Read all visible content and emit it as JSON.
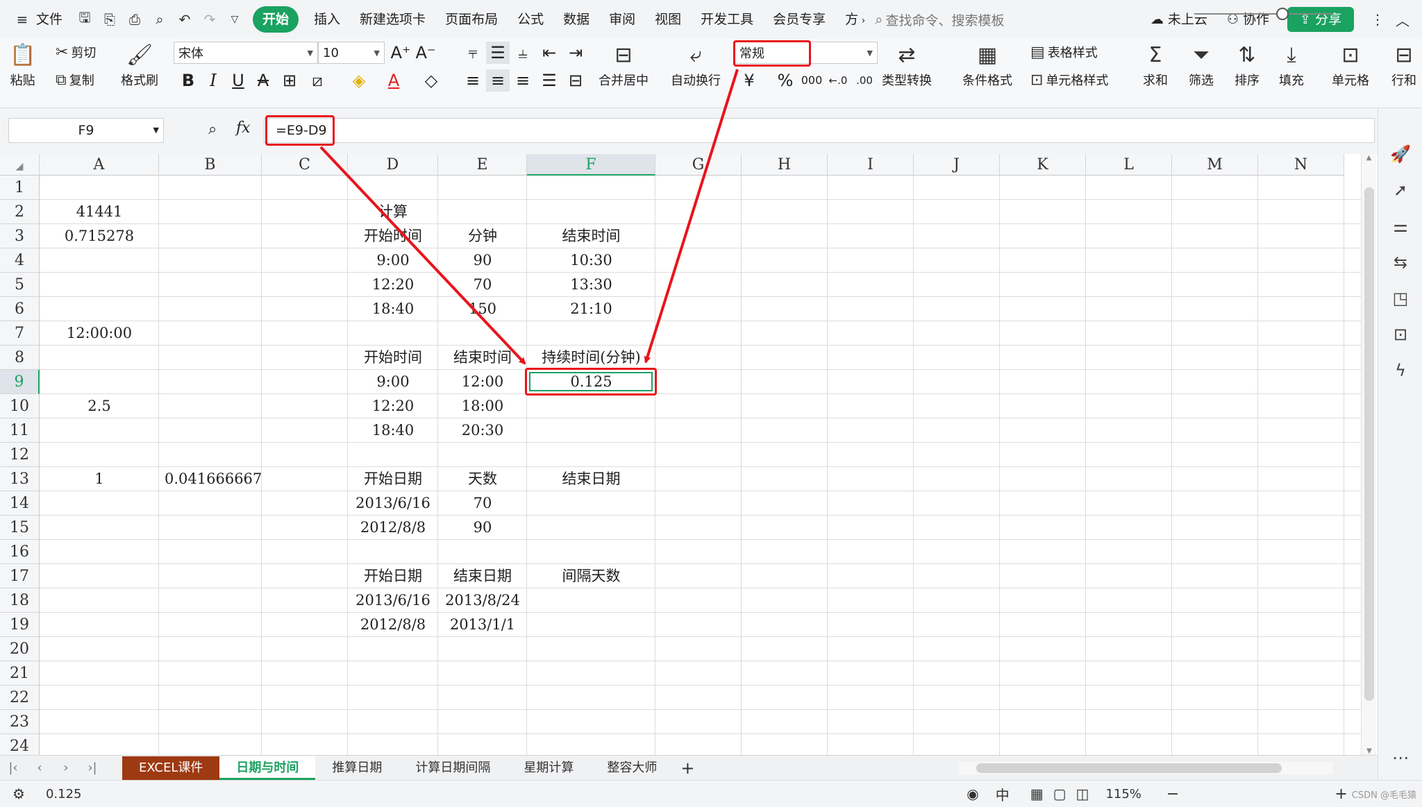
{
  "menu": {
    "file": "文件",
    "tabs": [
      "开始",
      "插入",
      "新建选项卡",
      "页面布局",
      "公式",
      "数据",
      "审阅",
      "视图",
      "开发工具",
      "会员专享",
      "方"
    ],
    "search_placeholder": "查找命令、搜索模板",
    "cloud": "未上云",
    "collab": "协作",
    "share": "分享"
  },
  "ribbon": {
    "paste": "粘贴",
    "cut": "剪切",
    "copy": "复制",
    "format_painter": "格式刷",
    "font_name": "宋体",
    "font_size": "10",
    "merge_center": "合并居中",
    "wrap_text": "自动换行",
    "number_format": "常规",
    "type_convert": "类型转换",
    "conditional_format": "条件格式",
    "table_style": "表格样式",
    "cell_style": "单元格样式",
    "sum": "求和",
    "filter": "筛选",
    "sort": "排序",
    "fill": "填充",
    "cell": "单元格",
    "row_col": "行和"
  },
  "formula_bar": {
    "name_box": "F9",
    "fx": "fx",
    "formula": "=E9-D9"
  },
  "grid": {
    "columns": [
      "A",
      "B",
      "C",
      "D",
      "E",
      "F",
      "G",
      "H",
      "I",
      "J",
      "K",
      "L",
      "M",
      "N"
    ],
    "rows": [
      "1",
      "2",
      "3",
      "4",
      "5",
      "6",
      "7",
      "8",
      "9",
      "10",
      "11",
      "12",
      "13",
      "14",
      "15",
      "16",
      "17",
      "18",
      "19",
      "20",
      "21",
      "22",
      "23",
      "24"
    ],
    "cells": {
      "A2": "41441",
      "A3": "0.715278",
      "A7": "12:00:00",
      "A10": "2.5",
      "A13": "1",
      "B13": "0.041666667",
      "D2": "计算",
      "D3": "开始时间",
      "E3": "分钟",
      "F3": "结束时间",
      "D4": "9:00",
      "E4": "90",
      "F4": "10:30",
      "D5": "12:20",
      "E5": "70",
      "F5": "13:30",
      "D6": "18:40",
      "E6": "150",
      "F6": "21:10",
      "D8": "开始时间",
      "E8": "结束时间",
      "F8": "持续时间(分钟)",
      "D9": "9:00",
      "E9": "12:00",
      "F9": "0.125",
      "D10": "12:20",
      "E10": "18:00",
      "D11": "18:40",
      "E11": "20:30",
      "D13": "开始日期",
      "E13": "天数",
      "F13": "结束日期",
      "D14": "2013/6/16",
      "E14": "70",
      "D15": "2012/8/8",
      "E15": "90",
      "D17": "开始日期",
      "E17": "结束日期",
      "F17": "间隔天数",
      "D18": "2013/6/16",
      "E18": "2013/8/24",
      "D19": "2012/8/8",
      "E19": "2013/1/1"
    }
  },
  "sheets": [
    "EXCEL课件",
    "日期与时间",
    "推算日期",
    "计算日期间隔",
    "星期计算",
    "整容大师"
  ],
  "status": {
    "value": "0.125",
    "zoom": "115%",
    "watermark": "CSDN @毛毛猿"
  },
  "colors": {
    "accent": "#1aa260",
    "highlight_red": "#e8141c",
    "excel_tab": "#9e3a12"
  }
}
